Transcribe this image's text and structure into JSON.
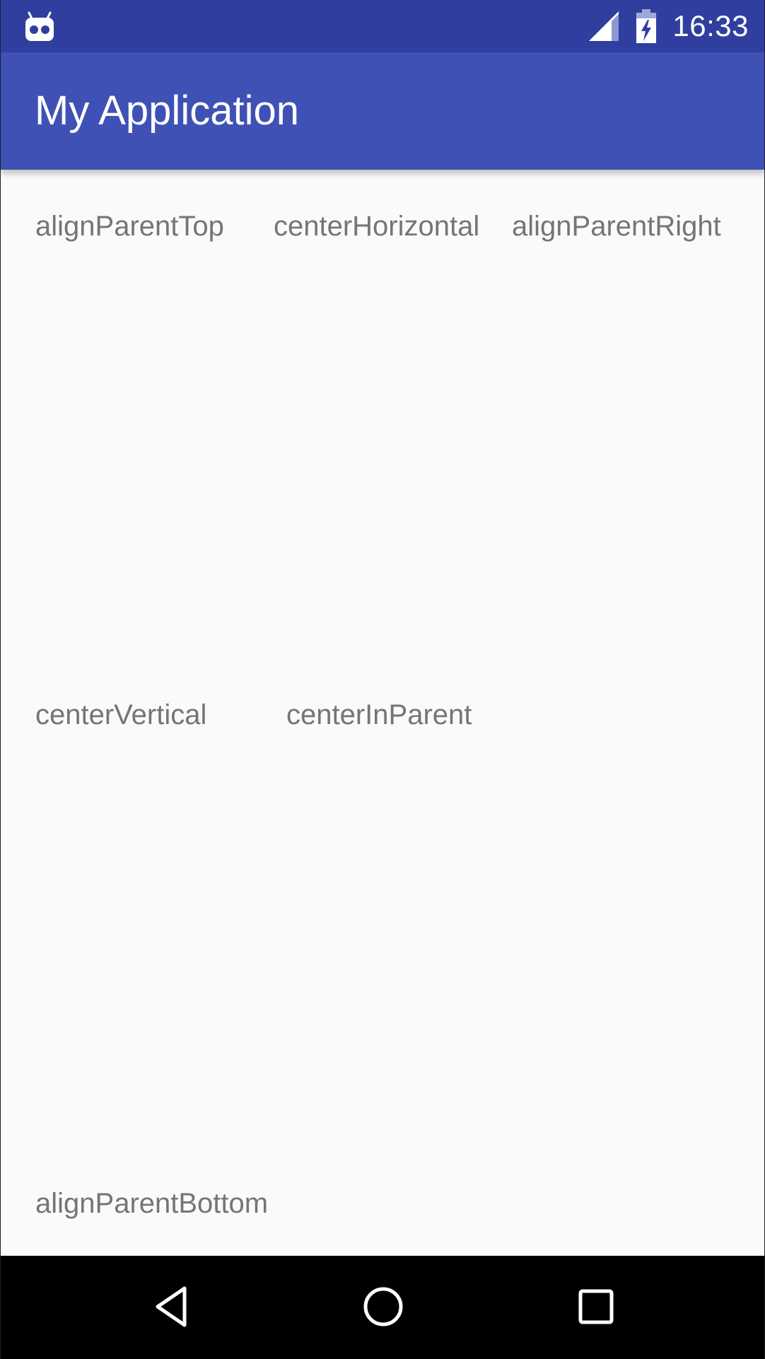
{
  "status_bar": {
    "time": "16:33",
    "notification_icon": "android-robot-icon",
    "signal_icon": "cell-signal-icon",
    "battery_icon": "battery-charging-icon",
    "background_color": "#303f9f"
  },
  "app_bar": {
    "title": "My Application",
    "background_color": "#3f51b5"
  },
  "content": {
    "labels": {
      "align_parent_top": "alignParentTop",
      "center_horizontal": "centerHorizontal",
      "align_parent_right": "alignParentRight",
      "center_vertical": "centerVertical",
      "center_in_parent": "centerInParent",
      "align_parent_bottom": "alignParentBottom"
    },
    "text_color": "#757575",
    "background_color": "#fafafa"
  },
  "nav_bar": {
    "back_icon": "back-triangle-icon",
    "home_icon": "home-circle-icon",
    "recents_icon": "recents-square-icon"
  }
}
